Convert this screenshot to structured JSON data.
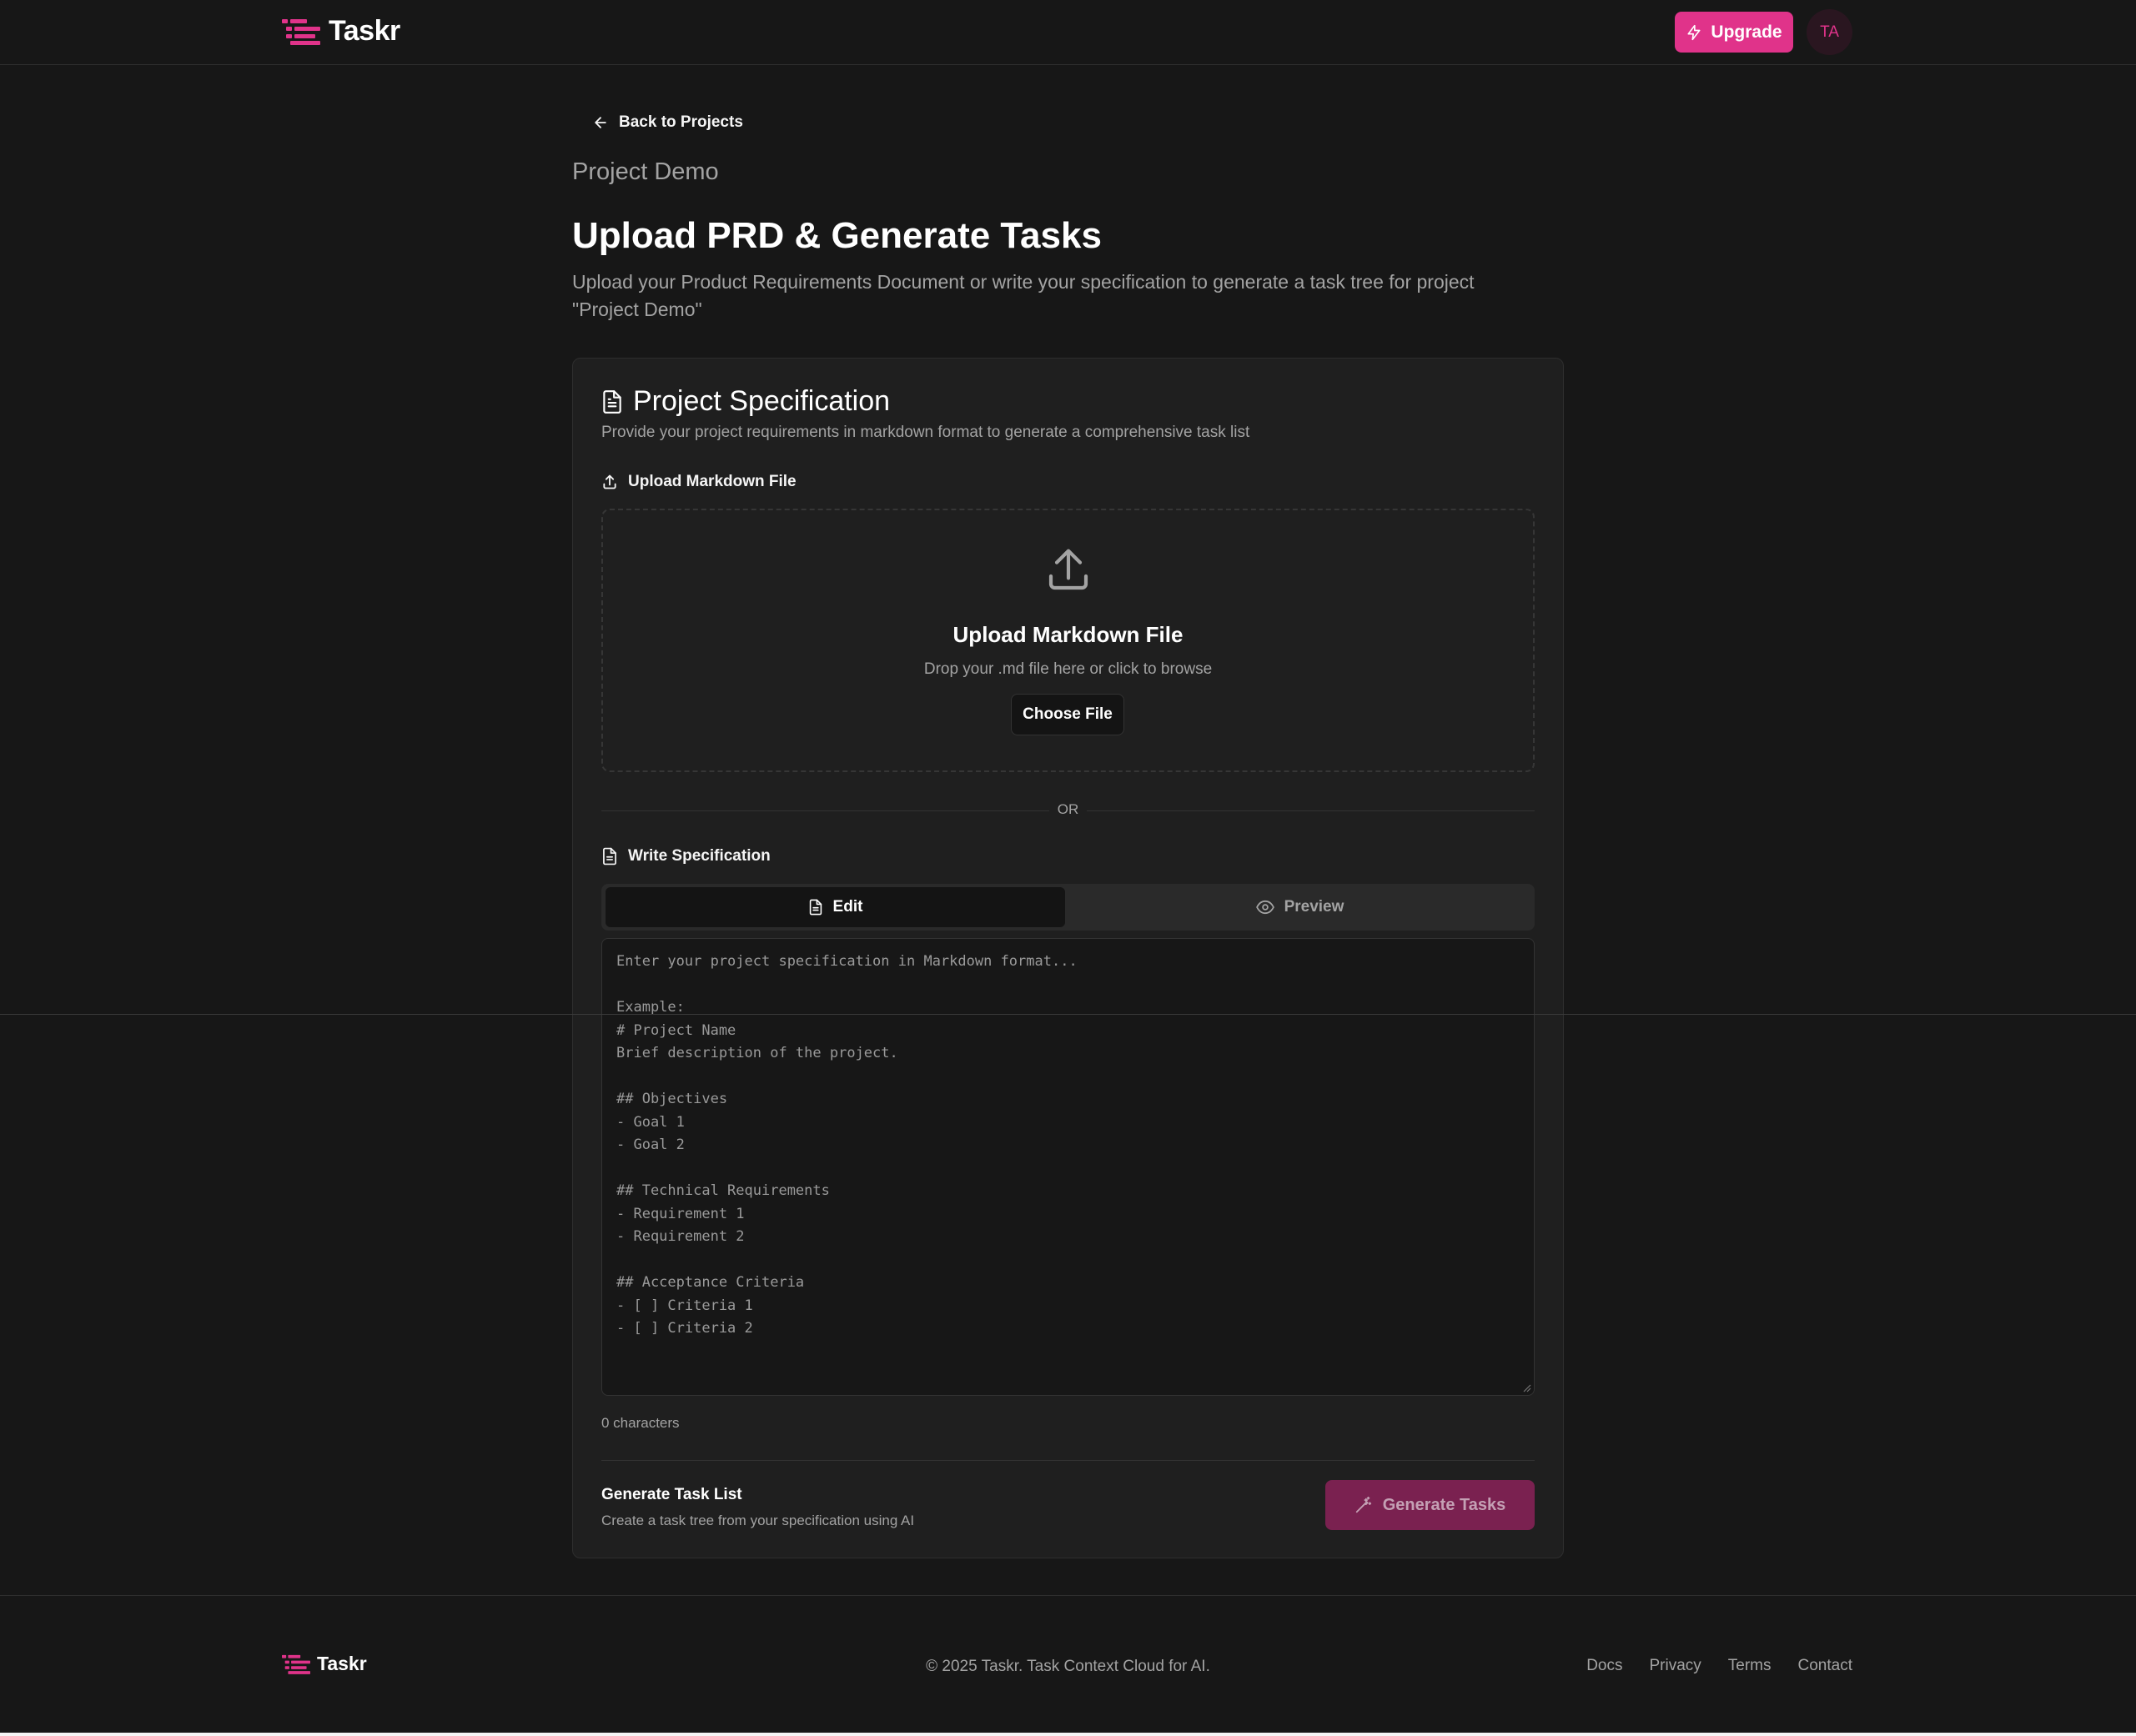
{
  "header": {
    "brand": "Taskr",
    "upgrade_label": "Upgrade",
    "avatar_initials": "TA",
    "accent_color": "#e0338a"
  },
  "main": {
    "back_label": "Back to Projects",
    "project_name": "Project Demo",
    "title": "Upload PRD & Generate Tasks",
    "description": "Upload your Product Requirements Document or write your specification to generate a task tree for project \"Project Demo\""
  },
  "card": {
    "title": "Project Specification",
    "subtitle": "Provide your project requirements in markdown format to generate a comprehensive task list",
    "upload_section_label": "Upload Markdown File",
    "dropzone": {
      "title": "Upload Markdown File",
      "hint": "Drop your .md file here or click to browse",
      "choose_label": "Choose File"
    },
    "or_label": "OR",
    "write_section_label": "Write Specification",
    "tabs": [
      {
        "label": "Edit",
        "active": true
      },
      {
        "label": "Preview",
        "active": false
      }
    ],
    "editor_placeholder": "Enter your project specification in Markdown format...\n\nExample:\n# Project Name\nBrief description of the project.\n\n## Objectives\n- Goal 1\n- Goal 2\n\n## Technical Requirements\n- Requirement 1\n- Requirement 2\n\n## Acceptance Criteria\n- [ ] Criteria 1\n- [ ] Criteria 2",
    "char_count": "0 characters",
    "generate": {
      "title": "Generate Task List",
      "subtitle": "Create a task tree from your specification using AI",
      "button_label": "Generate Tasks"
    }
  },
  "footer": {
    "brand": "Taskr",
    "copyright": "© 2025 Taskr. Task Context Cloud for AI.",
    "links": [
      "Docs",
      "Privacy",
      "Terms",
      "Contact"
    ]
  }
}
